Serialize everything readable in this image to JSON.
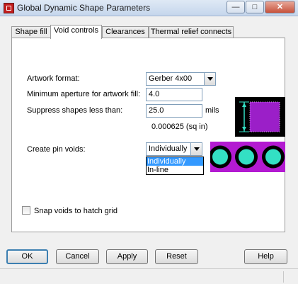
{
  "window": {
    "title": "Global Dynamic Shape Parameters"
  },
  "tabs": [
    "Shape fill",
    "Void controls",
    "Clearances",
    "Thermal relief connects"
  ],
  "active_tab": "Void controls",
  "form": {
    "artwork_format_label": "Artwork format:",
    "artwork_format_value": "Gerber 4x00",
    "min_aperture_label": "Minimum aperture for artwork fill:",
    "min_aperture_value": "4.0",
    "suppress_label": "Suppress shapes less than:",
    "suppress_value": "25.0",
    "suppress_unit": "mils",
    "suppress_area": "0.000625 (sq in)",
    "pin_voids_label": "Create pin voids:",
    "pin_voids_value": "Individually",
    "pin_voids_options": [
      "Individually",
      "In-line"
    ],
    "snap_label": "Snap voids to hatch grid",
    "snap_checked": false
  },
  "buttons": {
    "ok": "OK",
    "cancel": "Cancel",
    "apply": "Apply",
    "reset": "Reset",
    "help": "Help"
  },
  "colors": {
    "preview_bg": "#000000",
    "void_fill": "#9b1fc8",
    "pad_fill": "#33e0c4",
    "magenta_band": "#b31ad1"
  }
}
